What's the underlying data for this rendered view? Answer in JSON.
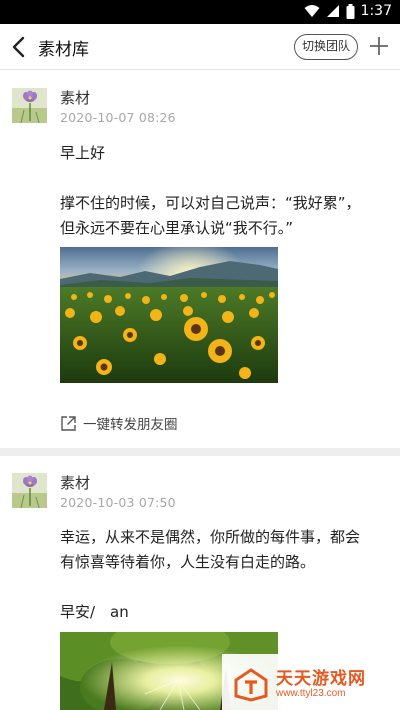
{
  "status_bar": {
    "time": "1:37",
    "icons": [
      "wifi-icon",
      "signal-icon",
      "battery-icon"
    ]
  },
  "header": {
    "title": "素材库",
    "switch_team_label": "切换团队",
    "back_icon": "chevron-left-icon",
    "add_icon": "plus-icon"
  },
  "posts": [
    {
      "author": "素材",
      "time": "2020-10-07 08:26",
      "text": "早上好\n\n撑不住的时候，可以对自己说声：“我好累”，\n但永远不要在心里承认说“我不行。”",
      "image": "sunflower-field-photo",
      "share_label": "一键转发朋友圈"
    },
    {
      "author": "素材",
      "time": "2020-10-03 07:50",
      "text": "幸运，从来不是偶然，你所做的每件事，都会\n有惊喜等待着你，人生没有白走的路。\n\n早安/　an",
      "image": "sunlit-trees-photo"
    }
  ],
  "watermark": {
    "title": "天天游戏网",
    "url": "www.ttyl23.com"
  },
  "colors": {
    "accent_watermark": "#e65a22",
    "divider": "#eeeeee",
    "secondary_text": "#a7a7a7"
  }
}
